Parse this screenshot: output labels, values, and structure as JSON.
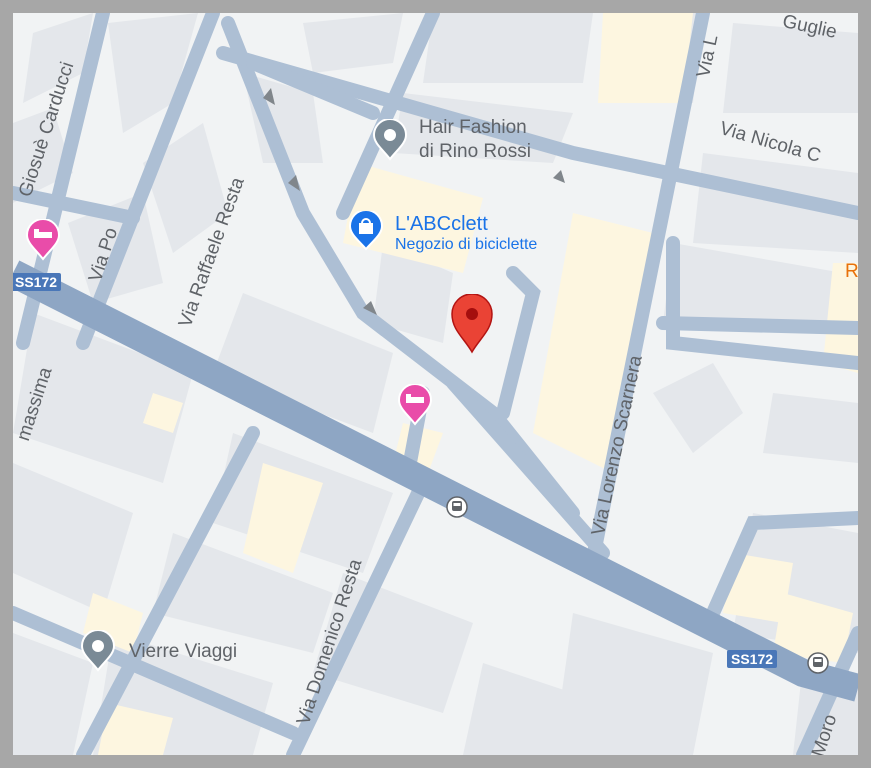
{
  "colors": {
    "background": "#f1f3f4",
    "block": "#e4e7eb",
    "block_yellow": "#fdf6e0",
    "road": "#adbfd4",
    "highway": "#8ea6c4",
    "label": "#5f6368",
    "accent_blue": "#1a73e8",
    "pin_red": "#ea4335",
    "hotel_pink": "#e94ca9",
    "route_shield": "#4a77b8"
  },
  "streets": [
    {
      "name": "Giosuè Carducci"
    },
    {
      "name": "Via Po"
    },
    {
      "name": "Via Raffaele Resta"
    },
    {
      "name": "Via Lorenzo Scarnera"
    },
    {
      "name": "Via Domenico Resta"
    },
    {
      "name": "Via Nicola C"
    },
    {
      "name": "Via L"
    },
    {
      "name": "Guglie"
    },
    {
      "name": "massima"
    },
    {
      "name": "Moro"
    }
  ],
  "pois": [
    {
      "name_line1": "Hair Fashion",
      "name_line2": "di Rino Rossi",
      "icon": "place-marker-icon"
    },
    {
      "name_line1": "L'ABCclett",
      "name_line2": "Negozio di biciclette",
      "icon": "shopping-bag-icon"
    },
    {
      "name_line1": "Vierre Viaggi",
      "icon": "place-marker-icon"
    }
  ],
  "route_shields": [
    "SS172",
    "SS172",
    "SS172"
  ],
  "partial_label": "R",
  "icons": [
    "hotel-icon",
    "hotel-icon",
    "bus-stop-icon",
    "bus-stop-icon",
    "location-pin-icon",
    "one-way-arrow-icon"
  ]
}
